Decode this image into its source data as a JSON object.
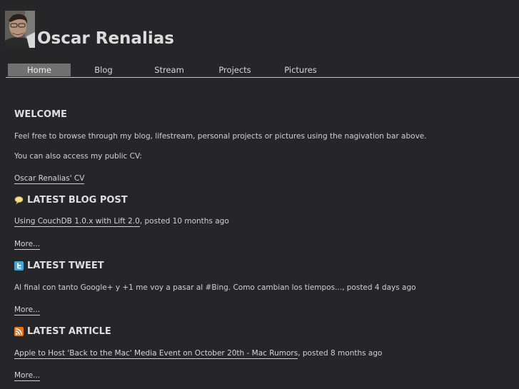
{
  "header": {
    "title": "Oscar Renalias"
  },
  "nav": {
    "items": [
      "Home",
      "Blog",
      "Stream",
      "Projects",
      "Pictures"
    ]
  },
  "welcome": {
    "title": "WELCOME",
    "intro": "Feel free to browse through my blog, lifestream, personal projects or pictures using the nagivation bar above.",
    "cv_text": "You can also access my public CV:",
    "cv_link": "Oscar Renalias' CV"
  },
  "blog": {
    "title": "LATEST BLOG POST",
    "icon": "speech-bubble-icon",
    "post_link": "Using CouchDB 1.0.x with Lift 2.0",
    "post_meta": ", posted 10 months ago",
    "more": "More..."
  },
  "tweet": {
    "title": "LATEST TWEET",
    "icon": "twitter-icon",
    "text": "Al final con tanto Google+ y +1 me voy a pasar al #Bing. Como cambian los tiempos..., posted 4 days ago",
    "more": "More..."
  },
  "article": {
    "title": "LATEST ARTICLE",
    "icon": "rss-icon",
    "link": "Apple to Host 'Back to the Mac' Media Event on October 20th - Mac Rumors",
    "meta": ", posted 8 months ago",
    "more": "More..."
  },
  "colors": {
    "background": "#262628",
    "nav_active": "#717171",
    "rss": "#e8741c",
    "twitter": "#3fa8d8"
  }
}
